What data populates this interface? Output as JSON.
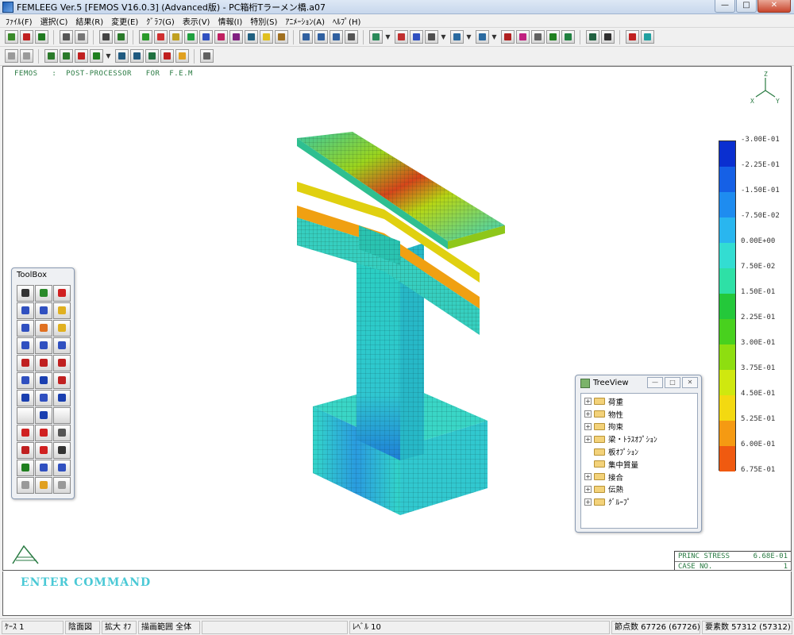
{
  "window": {
    "title": "FEMLEEG Ver.5 [FEMOS V16.0.3] (Advanced版) - PC箱桁Tラーメン橋.a07"
  },
  "menu": [
    "ﾌｧｲﾙ(F)",
    "選択(C)",
    "結果(R)",
    "変更(E)",
    "ｸﾞﾗﾌ(G)",
    "表示(V)",
    "情報(I)",
    "特別(S)",
    "ｱﾆﾒｰｼｮﾝ(A)",
    "ﾍﾙﾌﾟ(H)"
  ],
  "viewport": {
    "header": "FEMOS   :  POST-PROCESSOR   FOR  F.E.M",
    "axes": {
      "z": "Z",
      "x": "X",
      "y": "Y"
    }
  },
  "legend": {
    "labels": [
      "-3.00E-01",
      "-2.25E-01",
      "-1.50E-01",
      "-7.50E-02",
      "0.00E+00",
      "7.50E-02",
      "1.50E-01",
      "2.25E-01",
      "3.00E-01",
      "3.75E-01",
      "4.50E-01",
      "5.25E-01",
      "6.00E-01",
      "6.75E-01"
    ],
    "colors": [
      "#0a2fd0",
      "#1560e6",
      "#1e8cf0",
      "#29b6ef",
      "#33ddd2",
      "#2ee0a6",
      "#24c83a",
      "#48d11e",
      "#8ede10",
      "#cfe80f",
      "#f3d911",
      "#f59a12",
      "#f05a10",
      "#ec1414"
    ]
  },
  "stress_box": {
    "label": "PRINC STRESS",
    "value": "6.68E-01",
    "case_label": "CASE NO.",
    "case_value": "1"
  },
  "command": "ENTER COMMAND",
  "status": {
    "case": "ｹｰｽ 1",
    "hidden": "陰面図",
    "zoom": "拡大 ｵﾌ",
    "range": "描画範囲 全体",
    "level": "ﾚﾍﾞﾙ 10",
    "nodes": "節点数 67726 (67726)",
    "elements": "要素数 57312 (57312)"
  },
  "toolbox": {
    "title": "ToolBox"
  },
  "treeview": {
    "title": "TreeView",
    "items": [
      {
        "label": "荷重",
        "expandable": true
      },
      {
        "label": "物性",
        "expandable": true
      },
      {
        "label": "拘束",
        "expandable": true
      },
      {
        "label": "梁・ﾄﾗｽｵﾌﾟｼｮﾝ",
        "expandable": true
      },
      {
        "label": "板ｵﾌﾟｼｮﾝ",
        "expandable": false
      },
      {
        "label": "集中質量",
        "expandable": false
      },
      {
        "label": "接合",
        "expandable": true
      },
      {
        "label": "伝熱",
        "expandable": true
      },
      {
        "label": "ｸﾞﾙｰﾌﾟ",
        "expandable": true
      }
    ]
  }
}
